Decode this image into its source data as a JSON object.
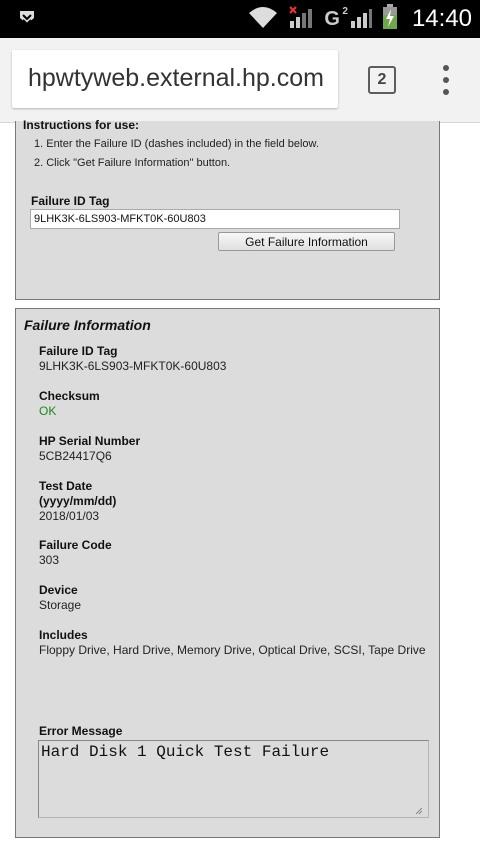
{
  "status_bar": {
    "time": "14:40",
    "network_label": "G",
    "network_sup": "2",
    "icons": [
      "download-notification-icon",
      "wifi-icon",
      "signal-icon",
      "signal-icon",
      "battery-charging-icon"
    ]
  },
  "browser": {
    "url": "hpwtyweb.external.hp.com",
    "tab_count": "2",
    "menu_icon": "overflow-menu-icon"
  },
  "instructions": {
    "heading": "Instructions for use:",
    "steps": [
      "1. Enter the Failure ID (dashes included) in the field below.",
      "2. Click \"Get Failure Information\" button."
    ]
  },
  "lookup": {
    "label": "Failure ID Tag",
    "input_value": "9LHK3K-6LS903-MFKT0K-60U803",
    "button_label": "Get Failure Information"
  },
  "failure_info": {
    "title": "Failure Information",
    "fields": [
      {
        "label": "Failure ID Tag",
        "value": "9LHK3K-6LS903-MFKT0K-60U803"
      },
      {
        "label": "Checksum",
        "value": "OK"
      },
      {
        "label": "HP Serial Number",
        "value": "5CB24417Q6"
      },
      {
        "label": "Test Date\n(yyyy/mm/dd)",
        "value": "2018/01/03"
      },
      {
        "label": "Failure Code",
        "value": "303"
      },
      {
        "label": "Device",
        "value": "Storage"
      },
      {
        "label": "Includes",
        "value": "Floppy Drive, Hard Drive, Memory Drive, Optical Drive, SCSI, Tape Drive"
      }
    ],
    "error_label": "Error Message",
    "error_message": "Hard Disk 1 Quick Test Failure"
  },
  "colors": {
    "status_ok": "#1a8a1a",
    "panel_bg": "#dcdcdc"
  }
}
